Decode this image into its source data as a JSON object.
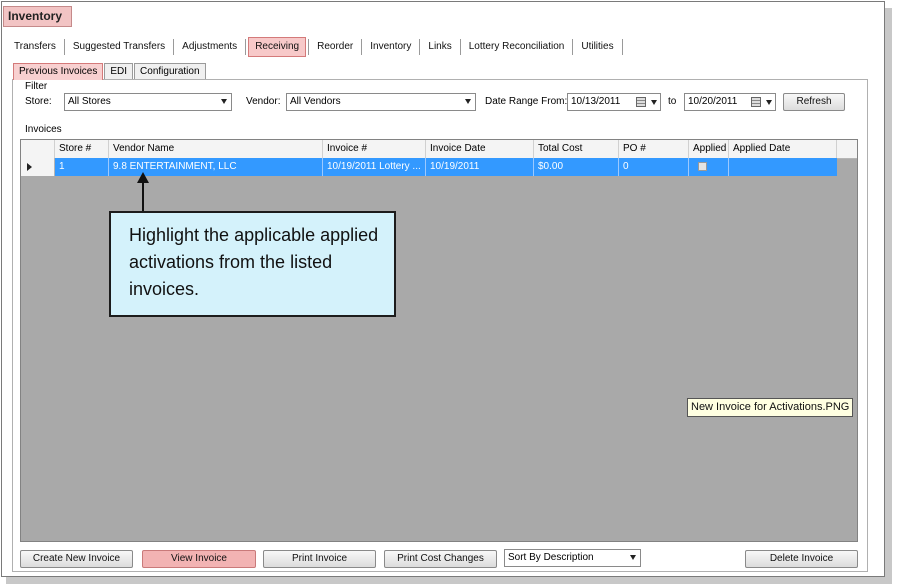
{
  "app_title": "Inventory",
  "top_tabs": [
    "Transfers",
    "Suggested Transfers",
    "Adjustments",
    "Receiving",
    "Reorder",
    "Inventory",
    "Links",
    "Lottery Reconciliation",
    "Utilities"
  ],
  "active_top_tab": "Receiving",
  "sub_tabs": [
    "Previous Invoices",
    "EDI",
    "Configuration"
  ],
  "active_sub_tab": "Previous Invoices",
  "filter": {
    "group_label": "Filter",
    "store_label": "Store:",
    "store_value": "All Stores",
    "vendor_label": "Vendor:",
    "vendor_value": "All Vendors",
    "date_range_label": "Date Range From:",
    "date_from": "10/13/2011",
    "to_label": "to",
    "date_to": "10/20/2011",
    "refresh_label": "Refresh"
  },
  "invoices": {
    "group_label": "Invoices",
    "columns": [
      "Store #",
      "Vendor Name",
      "Invoice #",
      "Invoice Date",
      "Total Cost",
      "PO #",
      "Applied",
      "Applied Date"
    ],
    "rows": [
      {
        "store": "1",
        "vendor": "9.8 ENTERTAINMENT, LLC",
        "invoice": "10/19/2011 Lottery ...",
        "date": "10/19/2011",
        "total": "$0.00",
        "po": "0",
        "applied": false,
        "applied_date": ""
      }
    ]
  },
  "callout_text": "Highlight the applicable applied activations from the listed invoices.",
  "tooltip_text": "New Invoice for Activations.PNG",
  "bottom_buttons": {
    "create": "Create New Invoice",
    "view": "View Invoice",
    "print": "Print Invoice",
    "print_cost": "Print Cost Changes",
    "sort_value": "Sort By Description",
    "delete": "Delete Invoice"
  }
}
